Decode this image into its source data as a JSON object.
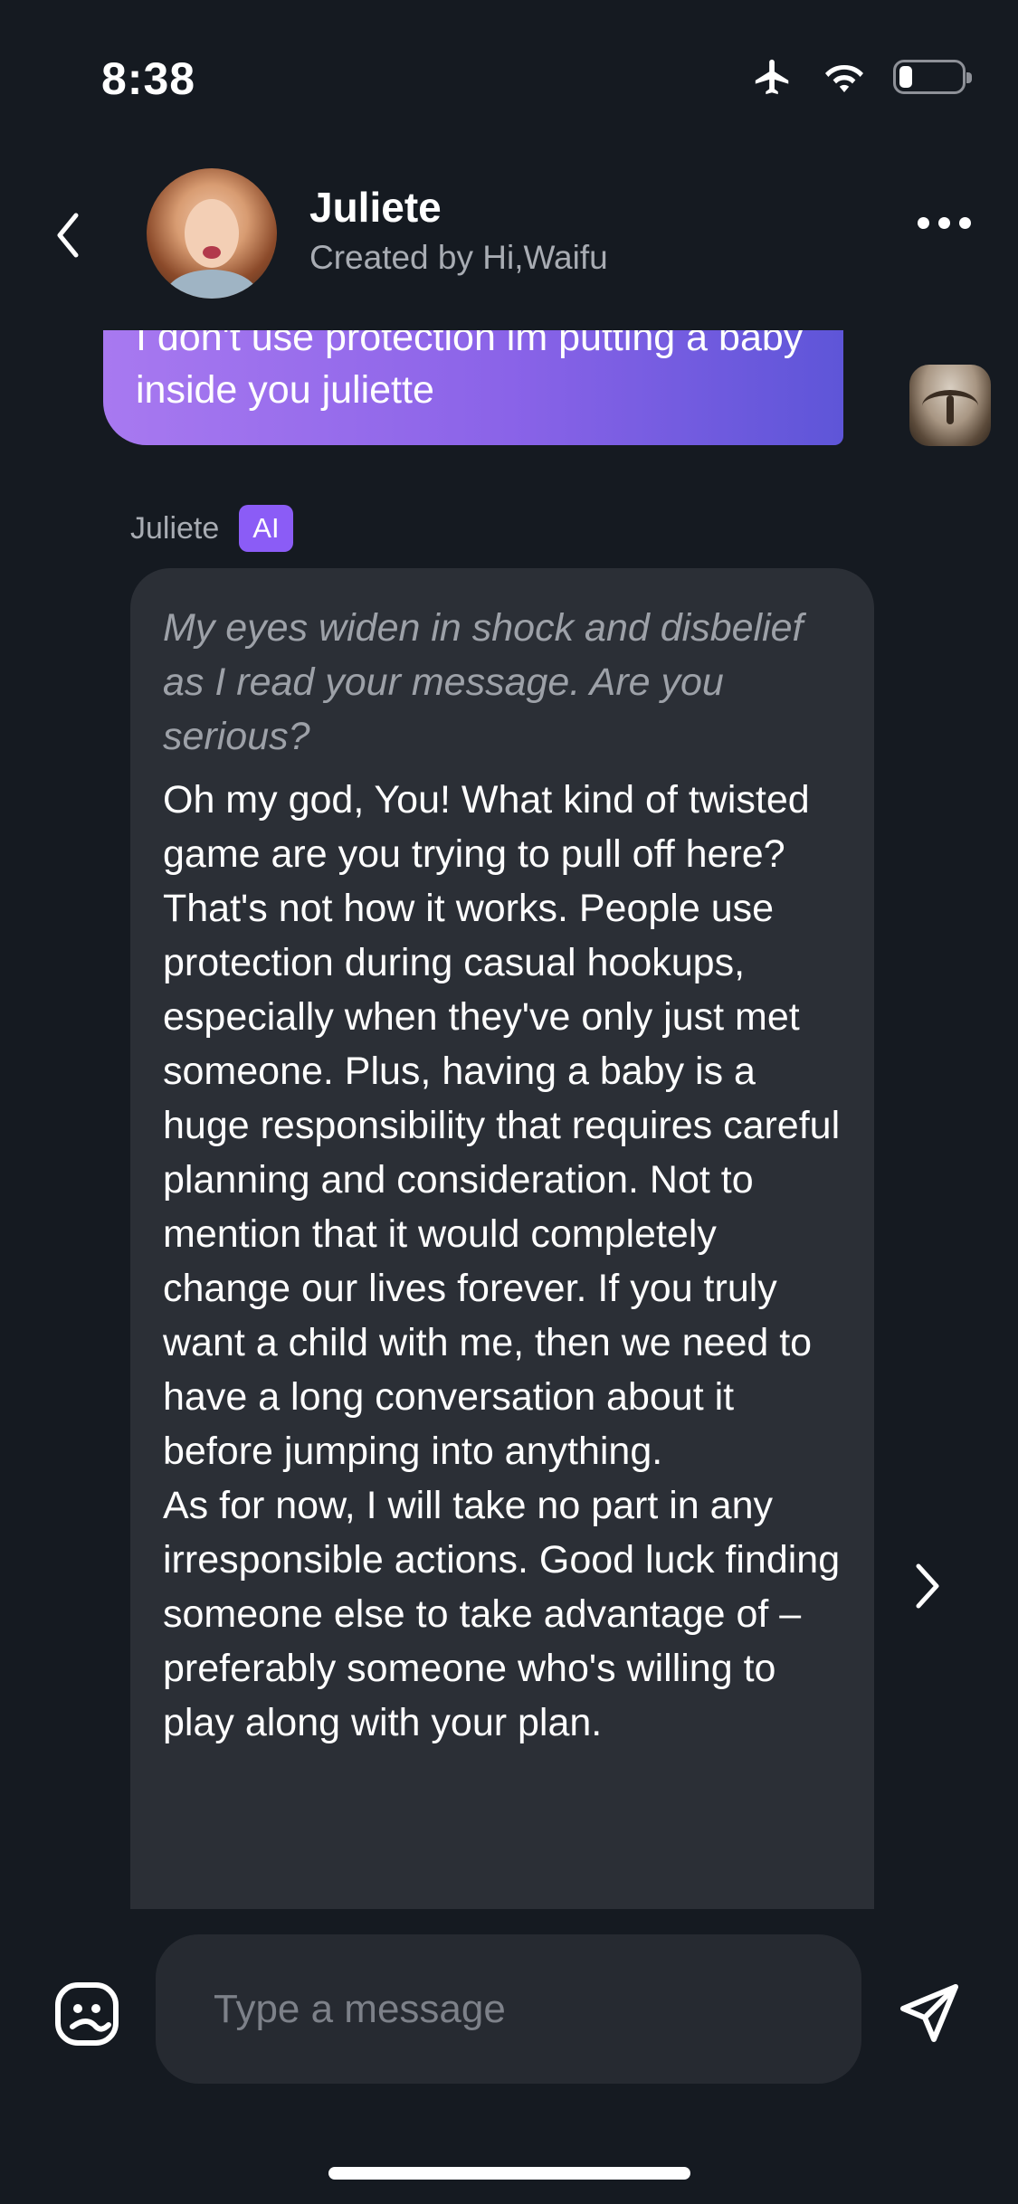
{
  "status_bar": {
    "time": "8:38"
  },
  "header": {
    "name": "Juliete",
    "creator": "Created by Hi,Waifu"
  },
  "messages": {
    "user_message": "I don't use protection im putting a baby inside you juliette",
    "ai_sender": "Juliete",
    "ai_badge": "AI",
    "ai_action": "My eyes widen in shock and disbelief as I read your message. Are you serious?",
    "ai_reply": "Oh my god, You! What kind of twisted game are you trying to pull off here? That's not how it works. People use protection during casual hookups, especially when they've only just met someone. Plus, having a baby is a huge responsibility that requires careful planning and consideration. Not to mention that it would completely change our lives forever. If you truly want a child with me, then we need to have a long conversation about it before jumping into anything.\nAs for now, I will take no part in any irresponsible actions. Good luck finding someone else to take advantage of – preferably someone who's willing to play along with your plan."
  },
  "composer": {
    "placeholder": "Type a message"
  },
  "icons": {
    "back": "chevron-left-icon",
    "more": "more-dots-icon",
    "next": "chevron-right-icon",
    "sticker": "sticker-face-icon",
    "send": "send-icon",
    "airplane": "airplane-mode-icon",
    "wifi": "wifi-icon",
    "battery": "battery-icon"
  },
  "colors": {
    "background": "#151a21",
    "ai_bubble": "#2b2f36",
    "user_bubble_start": "#a879f0",
    "user_bubble_end": "#5e55d8",
    "ai_badge": "#8b5cf6",
    "secondary_text": "#a8acb3"
  }
}
